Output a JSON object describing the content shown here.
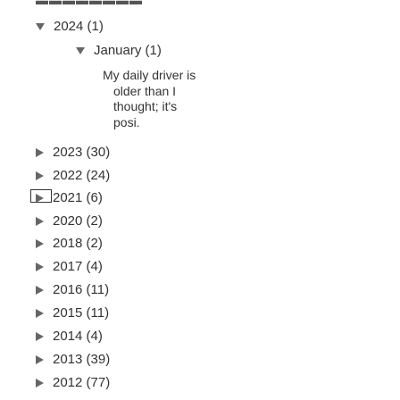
{
  "top_fragment": "",
  "archive": {
    "year_2024": "2024 (1)",
    "month_january": "January (1)",
    "post": {
      "title": "My daily driver is",
      "excerpt": "older than I thought; it's posi."
    },
    "years": [
      "2023 (30)",
      "2022 (24)",
      "2021 (6)",
      "2020 (2)",
      "2018 (2)",
      "2017 (4)",
      "2016 (11)",
      "2015 (11)",
      "2014 (4)",
      "2013 (39)",
      "2012 (77)"
    ]
  }
}
